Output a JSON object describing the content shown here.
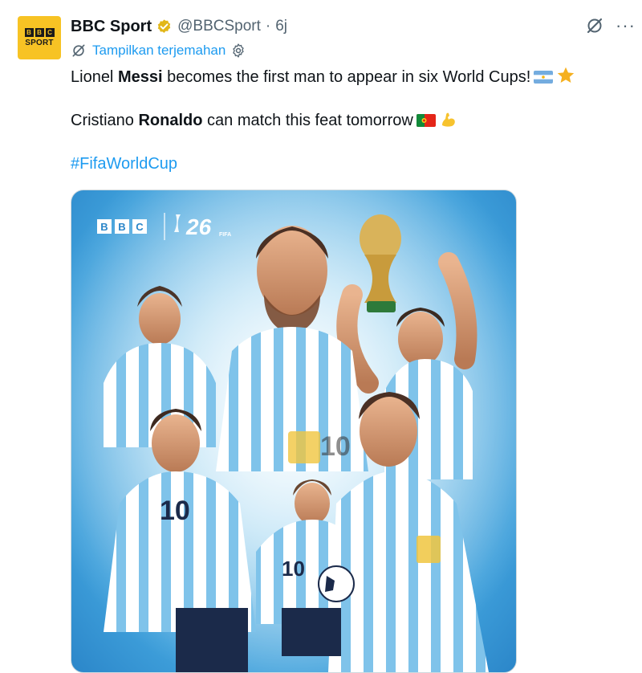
{
  "tweet": {
    "avatar_lines": {
      "blocks": [
        "B",
        "B",
        "C"
      ],
      "sport": "SPORT"
    },
    "display_name": "BBC Sport",
    "verified_badge": "gold-check",
    "handle": "@BBCSport",
    "separator": "·",
    "time": "6j",
    "more_label": "···",
    "translate_label": "Tampilkan terjemahan",
    "text": {
      "line1_pre": "Lionel ",
      "line1_bold": "Messi",
      "line1_post": " becomes the first man to appear in six World Cups!",
      "line2_pre": "Cristiano ",
      "line2_bold": "Ronaldo",
      "line2_post": " can match this feat tomorrow",
      "hashtag": "#FifaWorldCup"
    },
    "media": {
      "logo_blocks": [
        "B",
        "B",
        "C"
      ],
      "logo_26": "26",
      "logo_fifa": "FIFA",
      "jersey_number": "10"
    },
    "icons": [
      "bbc-sport-avatar",
      "verified-badge-icon",
      "grok-icon",
      "more-icon",
      "translate-icon",
      "settings-gear-icon",
      "argentina-flag-icon",
      "star-icon",
      "portugal-flag-icon",
      "flexed-bicep-icon"
    ],
    "colors": {
      "link": "#1d9bf0",
      "text": "#0f1419",
      "muted": "#536471",
      "avatar": "#f7c324",
      "verified": "#e2b719",
      "media_blue": "#3fa0db"
    }
  }
}
